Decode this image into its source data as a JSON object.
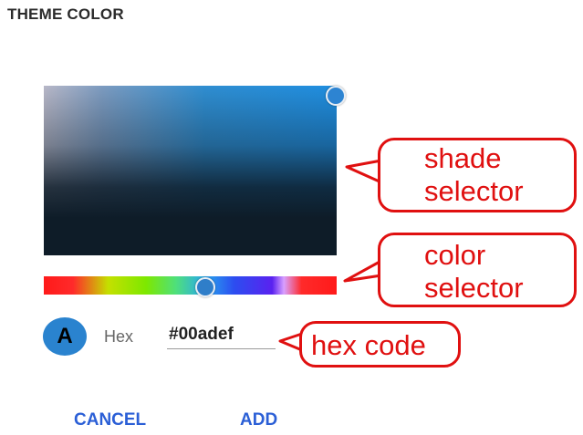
{
  "dialog": {
    "title": "THEME COLOR",
    "hex_label": "Hex",
    "hex_value": "#00adef",
    "avatar_letter": "A",
    "cancel_label": "CANCEL",
    "add_label": "ADD"
  },
  "annotations": {
    "shade": [
      "shade",
      "selector"
    ],
    "color": [
      "color",
      "selector"
    ],
    "hex": "hex code"
  },
  "colors": {
    "accent": "#2b5fd6",
    "annotation": "#e01010",
    "avatar": "#2a83cf"
  }
}
